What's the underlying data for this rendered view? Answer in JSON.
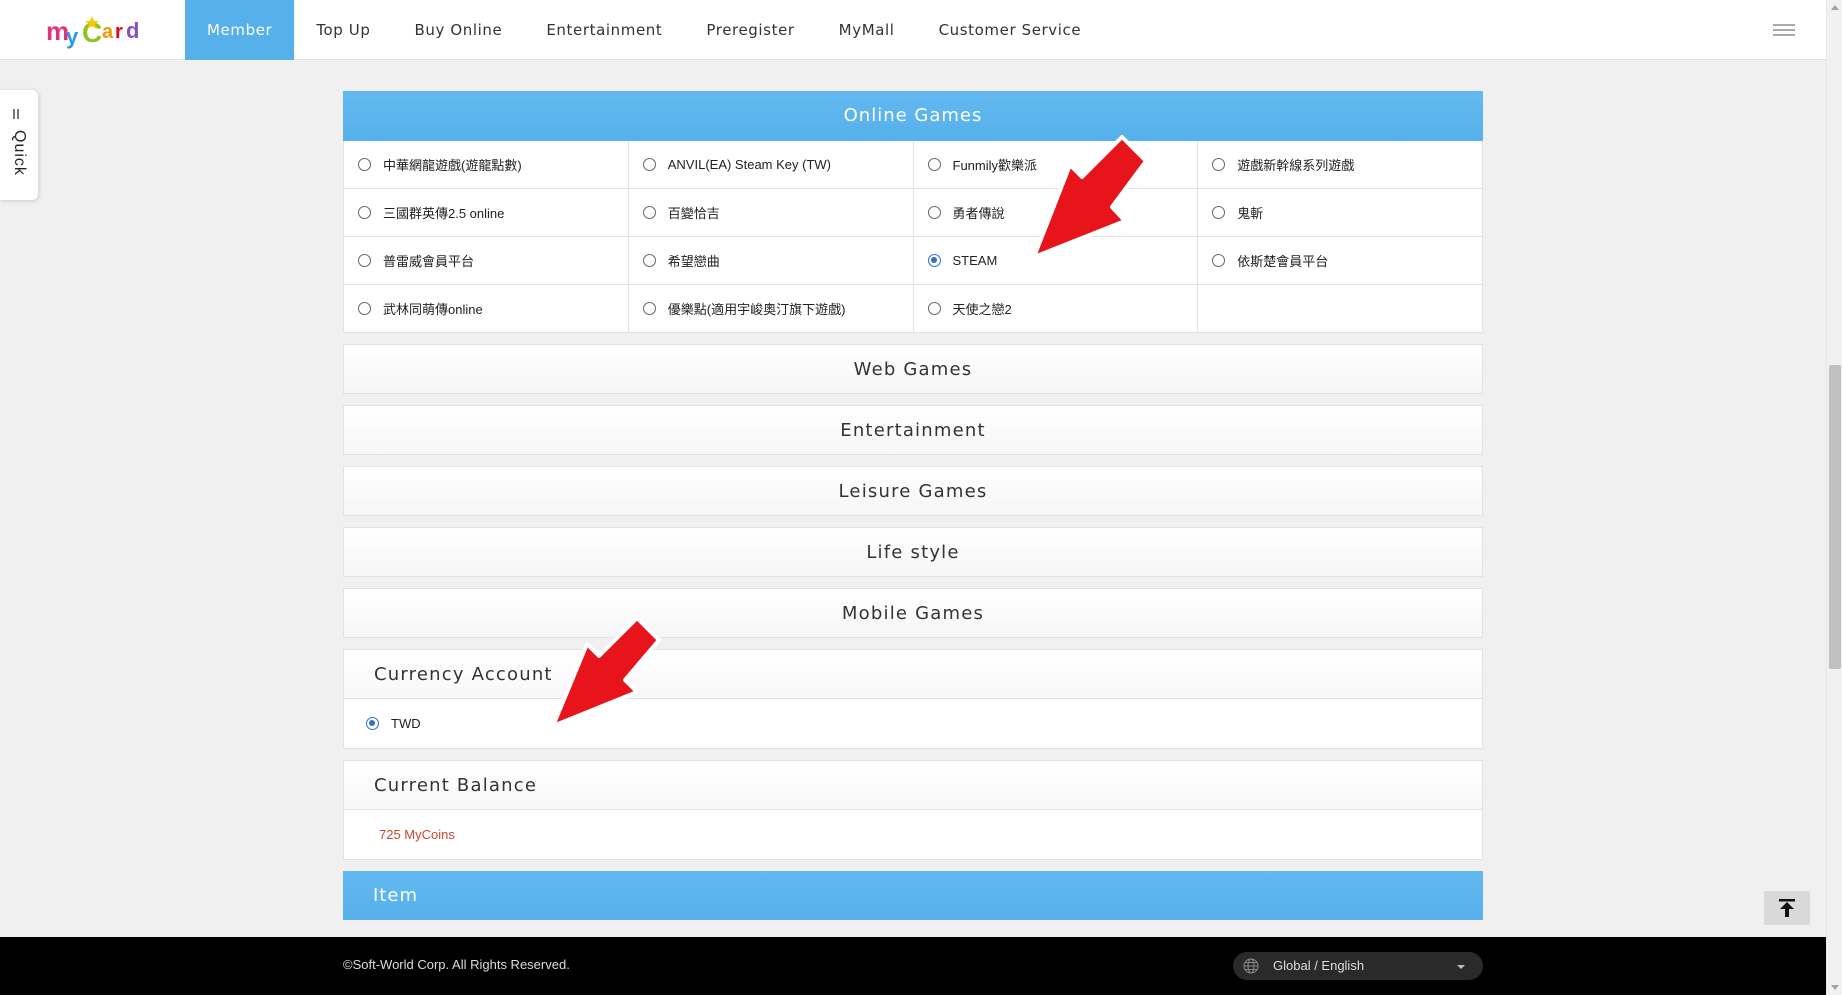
{
  "brand": {
    "logo_letters": [
      "m",
      "y",
      "C",
      "a",
      "r",
      "d"
    ],
    "logo_colors": [
      "#e4317c",
      "#2d9be0",
      "#8fc31f",
      "#f39800",
      "#e60012",
      "#8a4fbf"
    ]
  },
  "nav": {
    "items": [
      {
        "label": "Member",
        "active": true
      },
      {
        "label": "Top Up",
        "active": false
      },
      {
        "label": "Buy Online",
        "active": false
      },
      {
        "label": "Entertainment",
        "active": false
      },
      {
        "label": "Preregister",
        "active": false
      },
      {
        "label": "MyMall",
        "active": false
      },
      {
        "label": "Customer Service",
        "active": false
      }
    ],
    "menu_icon": "hamburger-icon"
  },
  "quick": {
    "label": "Quick",
    "icon": "list-icon"
  },
  "online_games": {
    "title": "Online Games",
    "items": [
      {
        "label": "中華網龍遊戲(遊龍點數)",
        "checked": false
      },
      {
        "label": "ANVIL(EA) Steam Key (TW)",
        "checked": false
      },
      {
        "label": "Funmily歡樂派",
        "checked": false
      },
      {
        "label": "遊戲新幹線系列遊戲",
        "checked": false
      },
      {
        "label": "三國群英傳2.5 online",
        "checked": false
      },
      {
        "label": "百變恰吉",
        "checked": false
      },
      {
        "label": "勇者傳說",
        "checked": false
      },
      {
        "label": "鬼斬",
        "checked": false
      },
      {
        "label": "普雷威會員平台",
        "checked": false
      },
      {
        "label": "希望戀曲",
        "checked": false
      },
      {
        "label": "STEAM",
        "checked": true
      },
      {
        "label": "依斯楚會員平台",
        "checked": false
      },
      {
        "label": "武林同萌傳online",
        "checked": false
      },
      {
        "label": "優樂點(適用宇峻奧汀旗下遊戲)",
        "checked": false
      },
      {
        "label": "天使之戀2",
        "checked": false
      },
      {
        "label": "",
        "checked": false,
        "empty": true
      }
    ]
  },
  "categories": {
    "web_games": "Web Games",
    "entertainment": "Entertainment",
    "leisure_games": "Leisure Games",
    "life_style": "Life style",
    "mobile_games": "Mobile Games"
  },
  "currency": {
    "title": "Currency Account",
    "option_label": "TWD",
    "checked": true
  },
  "balance": {
    "title": "Current Balance",
    "value": "725 MyCoins",
    "color": "#c8452f"
  },
  "item_section": {
    "title": "Item"
  },
  "footer": {
    "copyright": "©Soft-World Corp. All Rights Reserved.",
    "language": "Global / English"
  },
  "colors": {
    "accent": "#56b0ea",
    "radio_checked": "#2f6fd6",
    "annotation_arrow": "#e8141c"
  },
  "icons": {
    "back_to_top": "back-to-top-icon",
    "globe": "globe-icon",
    "caret": "caret-down-icon"
  }
}
